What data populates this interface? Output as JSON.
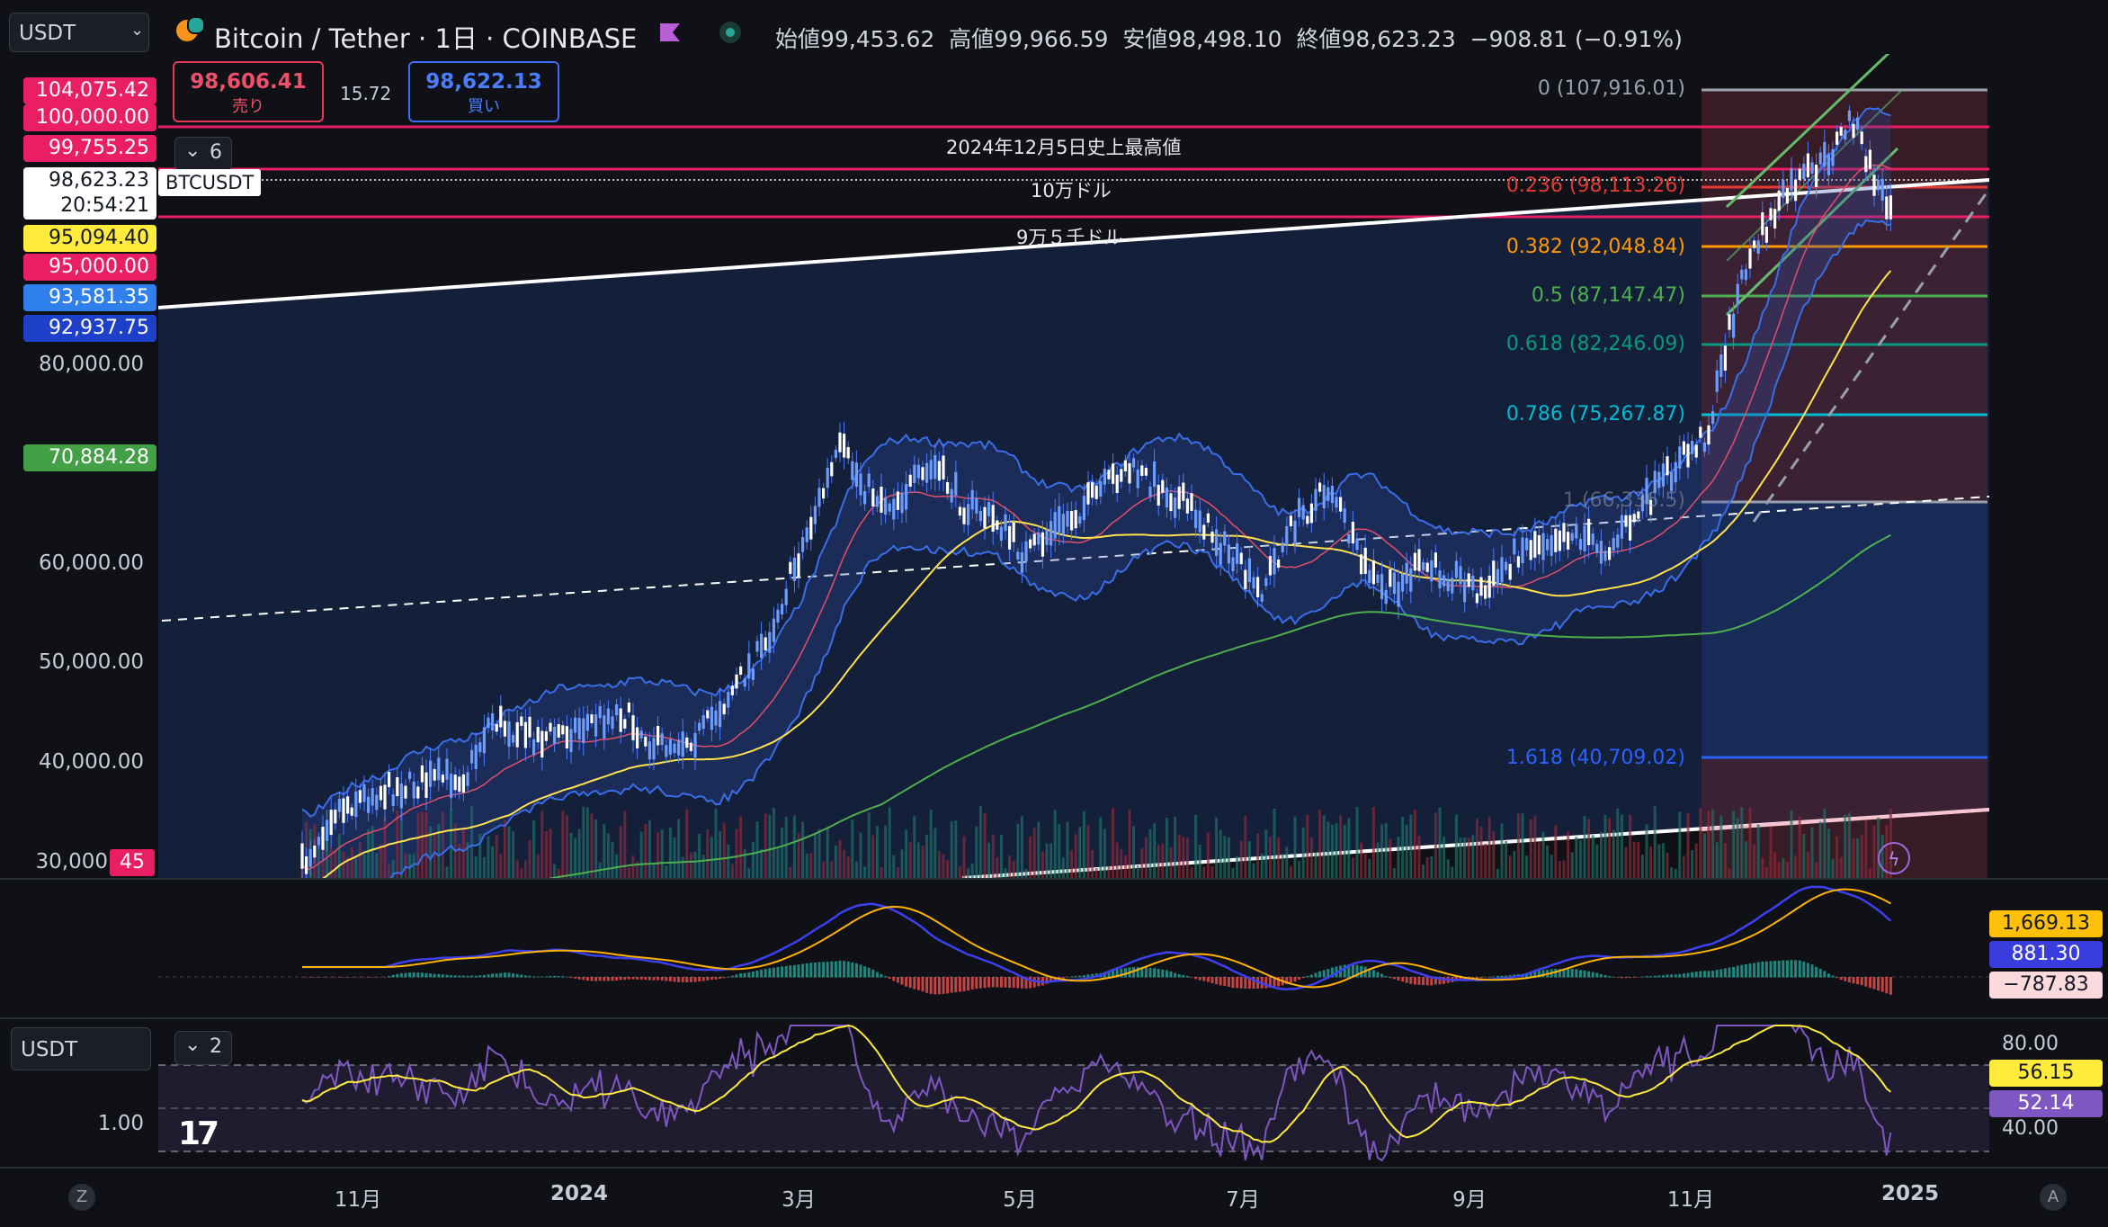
{
  "header": {
    "symbol_selector": "USDT",
    "title": "Bitcoin / Tether · 1日 · COINBASE",
    "ohlc": {
      "open_label": "始値",
      "open": "99,453.62",
      "high_label": "高値",
      "high": "99,966.59",
      "low_label": "安値",
      "low": "98,498.10",
      "close_label": "終値",
      "close": "98,623.23",
      "change": "−908.81 (−0.91%)"
    }
  },
  "trade": {
    "sell_price": "98,606.41",
    "sell_label": "売り",
    "spread": "15.72",
    "buy_price": "98,622.13",
    "buy_label": "買い"
  },
  "indicator_toggle": {
    "label": "6"
  },
  "symbol_tag": "BTCUSDT",
  "price_scale": {
    "pills": [
      {
        "value": "104,075.42",
        "bg": "#e91e63",
        "fg": "#ffffff"
      },
      {
        "value": "100,000.00",
        "bg": "#e91e63",
        "fg": "#ffffff"
      },
      {
        "value": "99,755.25",
        "bg": "#e91e63",
        "fg": "#ffffff"
      },
      {
        "value": "98,623.23",
        "bg": "#ffffff",
        "fg": "#131722"
      },
      {
        "value": "20:54:21",
        "bg": "#ffffff",
        "fg": "#131722"
      },
      {
        "value": "95,094.40",
        "bg": "#ffeb3b",
        "fg": "#131722"
      },
      {
        "value": "95,000.00",
        "bg": "#e91e63",
        "fg": "#ffffff"
      },
      {
        "value": "93,581.35",
        "bg": "#2f80ed",
        "fg": "#ffffff"
      },
      {
        "value": "92,937.75",
        "bg": "#1e40c8",
        "fg": "#ffffff"
      },
      {
        "value": "70,884.28",
        "bg": "#43a047",
        "fg": "#ffffff"
      }
    ],
    "ticks": [
      "80,000.00",
      "60,000.00",
      "50,000.00",
      "40,000.00",
      "30,000"
    ],
    "badge": "45"
  },
  "annotations": {
    "ath": "2024年12月5日史上最高値",
    "line_100k": "10万ドル",
    "line_95k": "9万５千ドル"
  },
  "fib": [
    {
      "label": "0 (107,916.01)",
      "color": "#9aa0ab"
    },
    {
      "label": "0.236 (98,113.26)",
      "color": "#e53935"
    },
    {
      "label": "0.382 (92,048.84)",
      "color": "#ff9800"
    },
    {
      "label": "0.5 (87,147.47)",
      "color": "#4caf50"
    },
    {
      "label": "0.618 (82,246.09)",
      "color": "#089981"
    },
    {
      "label": "0.786 (75,267.87)",
      "color": "#00bcd4"
    },
    {
      "label": "1 (66,336.5)",
      "color": "#9aa0ab"
    },
    {
      "label": "1.618 (40,709.02)",
      "color": "#2962ff"
    }
  ],
  "macd": {
    "values": [
      {
        "value": "1,669.13",
        "bg": "#ffc107",
        "fg": "#131722"
      },
      {
        "value": "881.30",
        "bg": "#3a3dde",
        "fg": "#ffffff"
      },
      {
        "value": "−787.83",
        "bg": "#fcd9dc",
        "fg": "#131722"
      }
    ]
  },
  "rsi": {
    "selector": "USDT",
    "toggle": "2",
    "scale_left": "1.00",
    "ticks": [
      "80.00",
      "40.00"
    ],
    "values": [
      {
        "value": "56.15",
        "bg": "#ffeb3b",
        "fg": "#131722"
      },
      {
        "value": "52.14",
        "bg": "#7e57c2",
        "fg": "#ffffff"
      }
    ]
  },
  "time_axis": [
    "11月",
    "2024",
    "3月",
    "5月",
    "7月",
    "9月",
    "11月",
    "2025"
  ],
  "bottom": {
    "left_btn": "Z",
    "right_btn": "A"
  }
}
